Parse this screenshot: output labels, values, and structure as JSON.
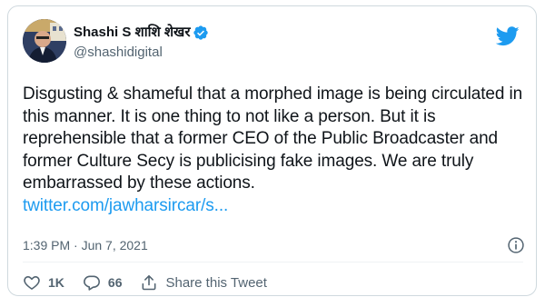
{
  "author": {
    "display_name": "Shashi S शाशि शेखर",
    "handle": "@shashidigital",
    "verified": true
  },
  "tweet": {
    "text": "Disgusting & shameful that a morphed image is being circulated in this manner. It is one thing to not like a person. But it is reprehensible that a former CEO of the Public Broadcaster and former Culture Secy is publicising fake images. We are truly embarrassed by these actions.",
    "link": "twitter.com/jawharsircar/s..."
  },
  "meta": {
    "timestamp": "1:39 PM · Jun 7, 2021"
  },
  "actions": {
    "like_count": "1K",
    "reply_count": "66",
    "share_label": "Share this Tweet"
  },
  "colors": {
    "brand_blue": "#1d9bf0",
    "text_primary": "#0f1419",
    "text_secondary": "#536471",
    "border": "#cfd9de"
  },
  "icons": {
    "logo": "twitter-bird-icon",
    "verified": "verified-badge-icon",
    "info": "info-icon",
    "like": "heart-icon",
    "reply": "reply-bubble-icon",
    "share": "share-upload-icon"
  }
}
